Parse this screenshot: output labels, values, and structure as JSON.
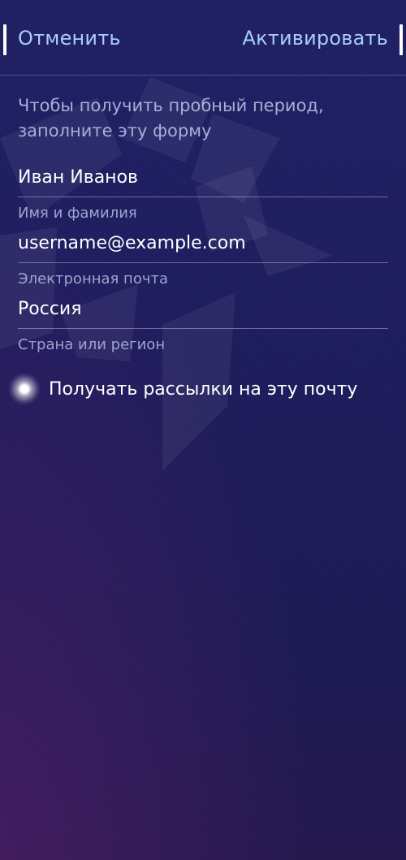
{
  "header": {
    "cancel_label": "Отменить",
    "activate_label": "Активировать"
  },
  "form": {
    "intro_text": "Чтобы получить пробный период, заполните эту форму",
    "fields": [
      {
        "value": "Иван Иванов",
        "label": "Имя и фамилия"
      },
      {
        "value": "username@example.com",
        "label": "Электронная почта"
      },
      {
        "value": "Россия",
        "label": "Страна или регион"
      }
    ],
    "newsletter": {
      "label": "Получать рассылки на эту почту",
      "checked": true
    }
  },
  "colors": {
    "accent": "#a9cdfb",
    "background": "#1d1c5e",
    "text": "#ffffff",
    "muted_text": "#9ea4cf"
  },
  "icons": {
    "watermark": "logo-watermark-icon",
    "checkbox": "glow-checkbox-icon"
  }
}
